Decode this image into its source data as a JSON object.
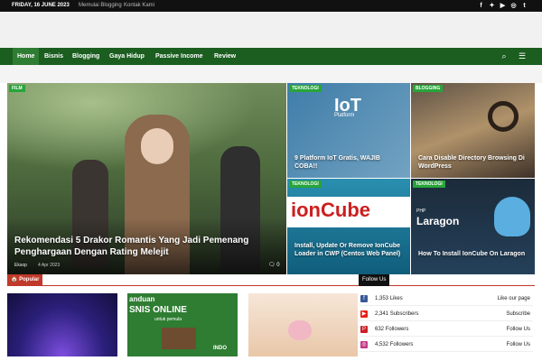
{
  "topbar": {
    "date": "FRIDAY, 16 JUNE 2023",
    "links": [
      "Memulai Blogging",
      "Kontak Kami"
    ]
  },
  "nav": {
    "items": [
      "Home",
      "Bisnis",
      "Blogging",
      "Gaya Hidup",
      "Passive Income",
      "Review"
    ]
  },
  "featured": {
    "tag": "FILM",
    "title": "Rekomendasi 5 Drakor Romantis Yang Jadi Pemenang Penghargaan Dengan Rating Melejit",
    "author": "Eksop",
    "date": "4 Apr 2023",
    "comments": "0"
  },
  "grid": [
    {
      "tag": "TEKNOLOGI",
      "title": "9 Platform IoT Gratis, WAJIB COBA!!",
      "art_main": "IoT",
      "art_sub": "Platform"
    },
    {
      "tag": "BLOGGING",
      "title": "Cara Disable Directory Browsing Di WordPress"
    },
    {
      "tag": "TEKNOLOGI",
      "title": "Install, Update Or Remove IonCube Loader in CWP (Centos Web Panel)",
      "art_main": "ionCube"
    },
    {
      "tag": "TEKNOLOGI",
      "title": "How To Install IonCube On Laragon",
      "art_main": "Laragon",
      "art_sub": "PHP"
    }
  ],
  "popular": {
    "label": "Popular"
  },
  "follow": {
    "label": "Follow Us"
  },
  "thumbs": [
    {
      "line1": "",
      "line2": ""
    },
    {
      "line1": "anduan",
      "line2": "SNIS ONLINE",
      "line3": "untuk pemula",
      "brand": "INDO"
    },
    {
      "line1": ""
    }
  ],
  "social": [
    {
      "icon": "f",
      "count": "1,353",
      "unit": "Likes",
      "action": "Like our page",
      "color": "#3b5998"
    },
    {
      "icon": "▶",
      "count": "2,341",
      "unit": "Subscribers",
      "action": "Subscribe",
      "color": "#e62117"
    },
    {
      "icon": "P",
      "count": "632",
      "unit": "Followers",
      "action": "Follow Us",
      "color": "#cb2027"
    },
    {
      "icon": "◎",
      "count": "4,532",
      "unit": "Followers",
      "action": "Follow Us",
      "color": "#c13584"
    }
  ]
}
